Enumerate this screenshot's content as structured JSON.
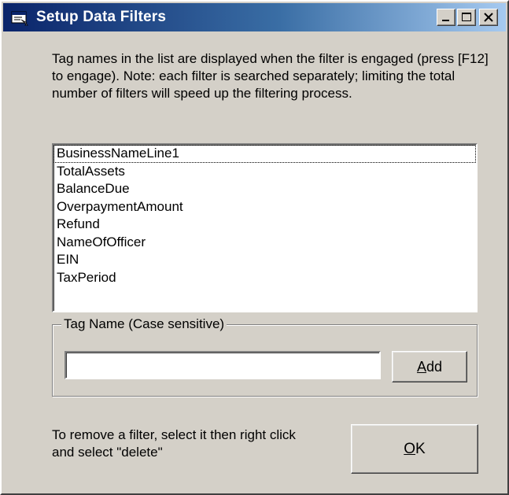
{
  "window": {
    "title": "Setup Data Filters",
    "icon": "app-window-icon",
    "controls": [
      "minimize-icon",
      "maximize-icon",
      "close-icon"
    ]
  },
  "description": "Tag names in the list are displayed when the filter is engaged (press [F12] to engage). Note: each filter is searched separately; limiting the total number of filters will speed up the filtering process.",
  "filters": {
    "items": [
      "BusinessNameLine1",
      "TotalAssets",
      "BalanceDue",
      "OverpaymentAmount",
      "Refund",
      "NameOfOfficer",
      "EIN",
      "TaxPeriod"
    ],
    "focused_index": 0
  },
  "tag_group": {
    "label": "Tag Name (Case sensitive)",
    "input_value": "",
    "add_button": {
      "mnemonic": "A",
      "rest": "dd"
    }
  },
  "footer": {
    "text": "To remove a filter, select it then right click and select \"delete\""
  },
  "ok_button": {
    "mnemonic": "O",
    "rest": "K"
  },
  "colors": {
    "title_gradient_start": "#0a246a",
    "title_gradient_end": "#a6caf0",
    "face": "#d4d0c8"
  }
}
